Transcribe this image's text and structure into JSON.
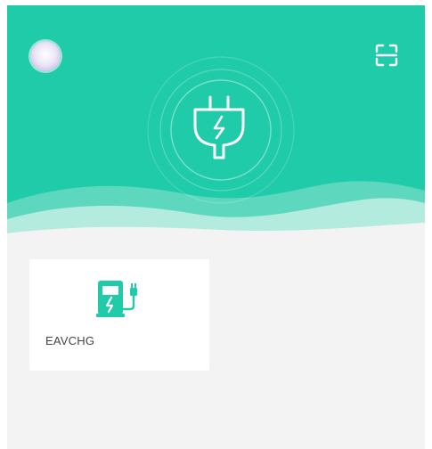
{
  "colors": {
    "brand": "#20cba9",
    "background": "#f3f3f3",
    "card": "#ffffff"
  },
  "header": {
    "avatar_icon": "avatar",
    "scan_icon": "scan-icon",
    "center_icon": "plug-icon"
  },
  "devices": [
    {
      "name": "EAVCHG",
      "icon": "charging-station-icon"
    }
  ]
}
